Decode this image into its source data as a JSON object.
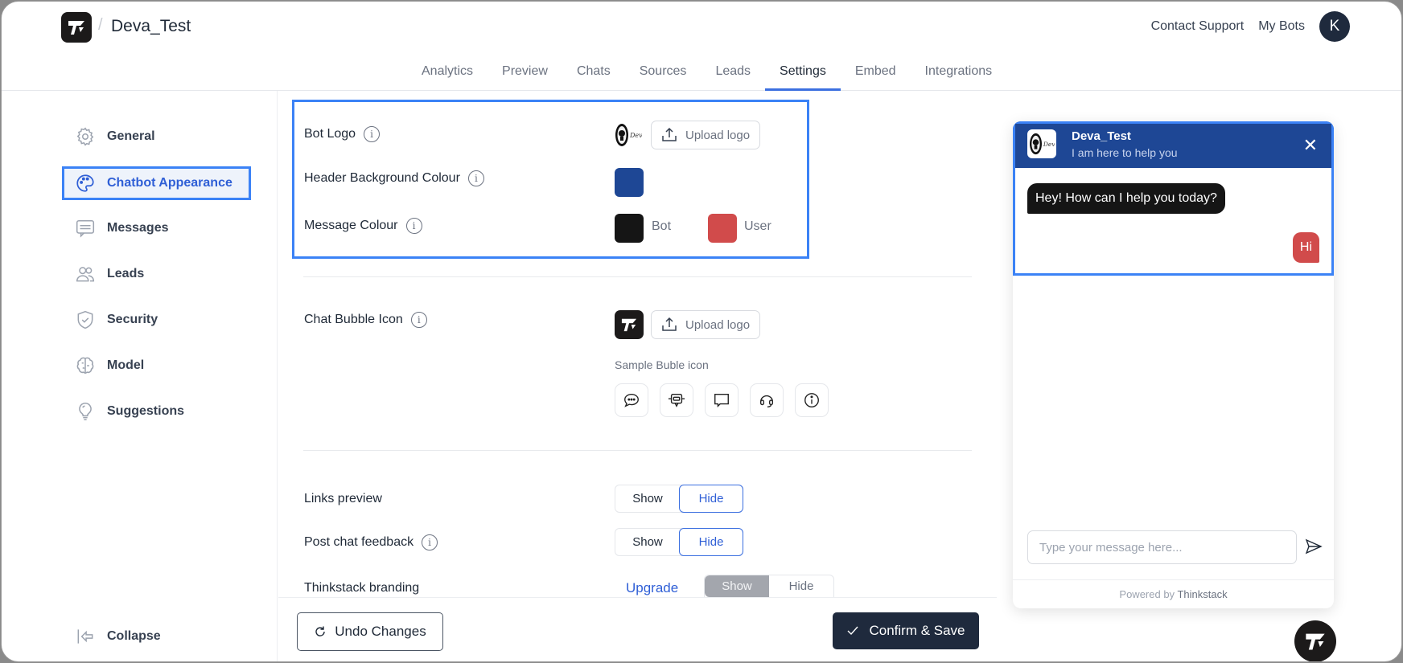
{
  "header": {
    "bot_name": "Deva_Test",
    "breadcrumb_separator": "/",
    "contact_support": "Contact Support",
    "my_bots": "My Bots",
    "avatar_initial": "K"
  },
  "tabs": [
    {
      "label": "Analytics",
      "active": false
    },
    {
      "label": "Preview",
      "active": false
    },
    {
      "label": "Chats",
      "active": false
    },
    {
      "label": "Sources",
      "active": false
    },
    {
      "label": "Leads",
      "active": false
    },
    {
      "label": "Settings",
      "active": true
    },
    {
      "label": "Embed",
      "active": false
    },
    {
      "label": "Integrations",
      "active": false
    }
  ],
  "sidebar": {
    "items": [
      {
        "label": "General",
        "icon": "gear-icon"
      },
      {
        "label": "Chatbot Appearance",
        "icon": "palette-icon",
        "active": true
      },
      {
        "label": "Messages",
        "icon": "message-icon"
      },
      {
        "label": "Leads",
        "icon": "users-icon"
      },
      {
        "label": "Security",
        "icon": "shield-check-icon"
      },
      {
        "label": "Model",
        "icon": "brain-icon"
      },
      {
        "label": "Suggestions",
        "icon": "lightbulb-icon"
      }
    ],
    "collapse_label": "Collapse"
  },
  "settings": {
    "bot_logo": {
      "label": "Bot Logo",
      "upload_label": "Upload logo"
    },
    "header_bg": {
      "label": "Header Background Colour",
      "color": "#1e4795"
    },
    "message_colour": {
      "label": "Message Colour",
      "bot_label": "Bot",
      "bot_color": "#151515",
      "user_label": "User",
      "user_color": "#d14b4b"
    },
    "chat_bubble": {
      "label": "Chat Bubble Icon",
      "upload_label": "Upload logo",
      "sample_label": "Sample Buble icon",
      "sample_icons": [
        "chat-dots-icon",
        "robot-chat-icon",
        "chat-square-icon",
        "headset-icon",
        "info-icon"
      ]
    },
    "links_preview": {
      "label": "Links preview",
      "show": "Show",
      "hide": "Hide",
      "selected": "Hide"
    },
    "post_chat_feedback": {
      "label": "Post chat feedback",
      "show": "Show",
      "hide": "Hide",
      "selected": "Hide"
    },
    "branding": {
      "label": "Thinkstack branding",
      "upgrade": "Upgrade",
      "show": "Show",
      "hide": "Hide",
      "selected": "Show"
    }
  },
  "actions": {
    "undo": "Undo Changes",
    "save": "Confirm & Save"
  },
  "chat_preview": {
    "title": "Deva_Test",
    "subtitle": "I am here to help you",
    "bot_message": "Hey! How can I help you today?",
    "user_message": "Hi",
    "input_placeholder": "Type your message here...",
    "powered_by": "Powered by",
    "powered_brand": "Thinkstack",
    "header_color": "#1e4795"
  }
}
